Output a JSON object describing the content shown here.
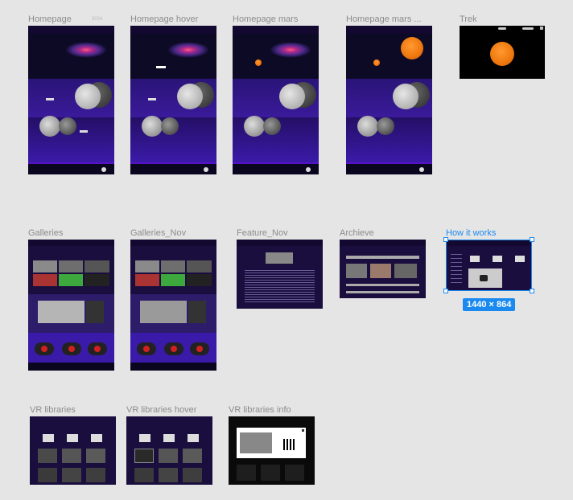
{
  "frames_row1": [
    {
      "label": "Homepage",
      "tag": "3034"
    },
    {
      "label": "Homepage hover"
    },
    {
      "label": "Homepage mars"
    },
    {
      "label": "Homepage mars ..."
    },
    {
      "label": "Trek"
    }
  ],
  "frames_row2": [
    {
      "label": "Galleries"
    },
    {
      "label": "Galleries_Nov"
    },
    {
      "label": "Feature_Nov"
    },
    {
      "label": "Archieve"
    },
    {
      "label": "How it works",
      "selected": true
    }
  ],
  "frames_row3": [
    {
      "label": "VR libraries"
    },
    {
      "label": "VR libraries hover"
    },
    {
      "label": "VR libraries info"
    }
  ],
  "selection": {
    "size_badge": "1440 × 864"
  },
  "colors": {
    "selection": "#1b8af0",
    "canvas": "#e5e5e5",
    "purple": "#5512c8",
    "mars": "#f07a10"
  }
}
